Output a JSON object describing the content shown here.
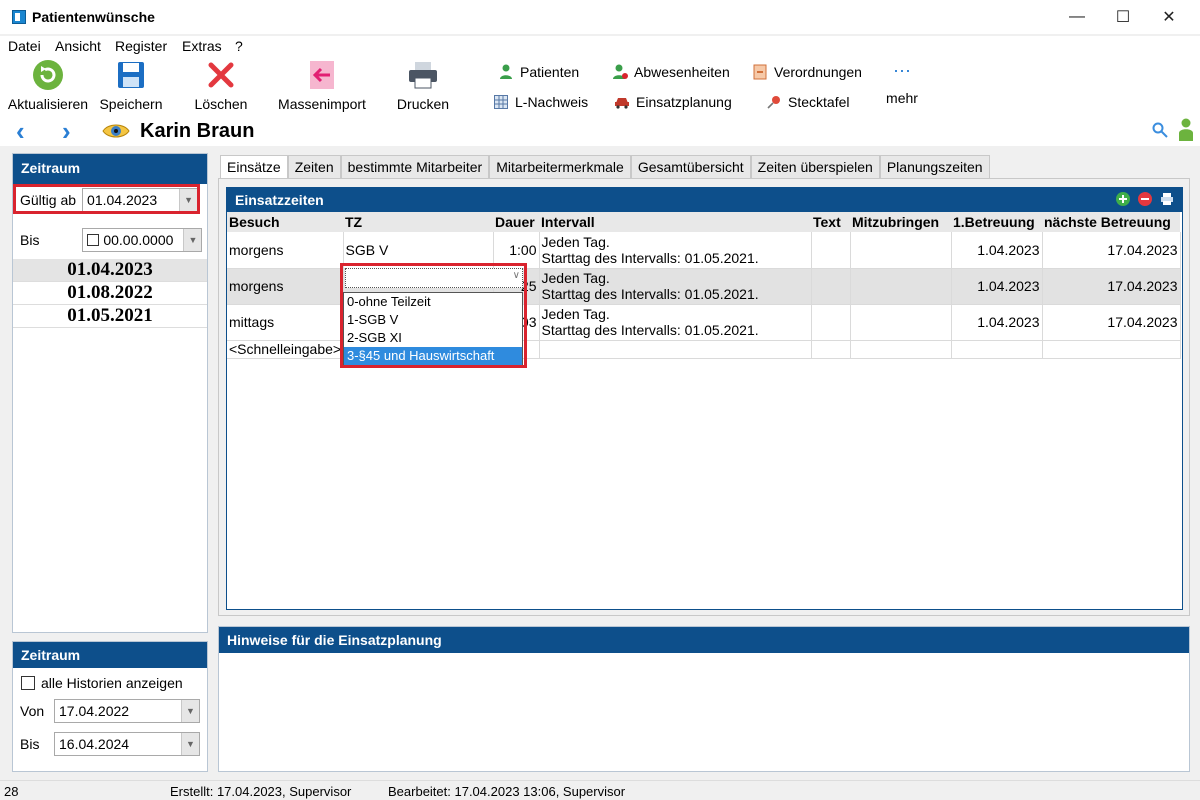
{
  "window": {
    "title": "Patientenwünsche"
  },
  "menu": [
    "Datei",
    "Ansicht",
    "Register",
    "Extras",
    "?"
  ],
  "toolbar": {
    "refresh": "Aktualisieren",
    "save": "Speichern",
    "delete": "Löschen",
    "import": "Massenimport",
    "print": "Drucken",
    "patients": "Patienten",
    "absences": "Abwesenheiten",
    "prescriptions": "Verordnungen",
    "l_proof": "L-Nachweis",
    "deployment": "Einsatzplanung",
    "pinboard": "Stecktafel",
    "more": "mehr"
  },
  "patient": {
    "name": "Karin Braun"
  },
  "period_top": {
    "title": "Zeitraum",
    "valid_from_label": "Gültig ab",
    "valid_from_value": "01.04.2023",
    "until_label": "Bis",
    "until_value": "00.00.0000",
    "dates": [
      "01.04.2023",
      "01.08.2022",
      "01.05.2021"
    ]
  },
  "period_bottom": {
    "title": "Zeitraum",
    "show_all_label": "alle Historien anzeigen",
    "from_label": "Von",
    "from_value": "17.04.2022",
    "until_label": "Bis",
    "until_value": "16.04.2024"
  },
  "tabs": [
    "Einsätze",
    "Zeiten",
    "bestimmte Mitarbeiter",
    "Mitarbeitermerkmale",
    "Gesamtübersicht",
    "Zeiten überspielen",
    "Planungszeiten"
  ],
  "einsatz": {
    "title": "Einsatzzeiten",
    "columns": [
      "Besuch",
      "TZ",
      "Dauer",
      "Intervall",
      "Text",
      "Mitzubringen",
      "1.Betreuung",
      "nächste Betreuung"
    ],
    "rows": [
      {
        "besuch": "morgens",
        "tz": "SGB V",
        "dauer": "1:00",
        "intervall1": "Jeden Tag.",
        "intervall2": "Starttag des Intervalls: 01.05.2021.",
        "erste": "1.04.2023",
        "naechste": "17.04.2023"
      },
      {
        "besuch": "morgens",
        "tz": "",
        "dauer": "25",
        "intervall1": "Jeden Tag.",
        "intervall2": "Starttag des Intervalls: 01.05.2021.",
        "erste": "1.04.2023",
        "naechste": "17.04.2023"
      },
      {
        "besuch": "mittags",
        "tz": "",
        "dauer": "03",
        "intervall1": "Jeden Tag.",
        "intervall2": "Starttag des Intervalls: 01.05.2021.",
        "erste": "1.04.2023",
        "naechste": "17.04.2023"
      }
    ],
    "quick_entry": "<Schnelleingabe>",
    "dropdown_options": [
      "0-ohne Teilzeit",
      "1-SGB V",
      "2-SGB XI",
      "3-§45 und Hauswirtschaft"
    ]
  },
  "hints": {
    "title": "Hinweise für die Einsatzplanung"
  },
  "status": {
    "count": "28",
    "created": "Erstellt: 17.04.2023, Supervisor",
    "edited": "Bearbeitet: 17.04.2023 13:06, Supervisor"
  },
  "colors": {
    "header_blue": "#0d4f8b",
    "highlight_red": "#d9232e",
    "selection_blue": "#2f8bde"
  }
}
